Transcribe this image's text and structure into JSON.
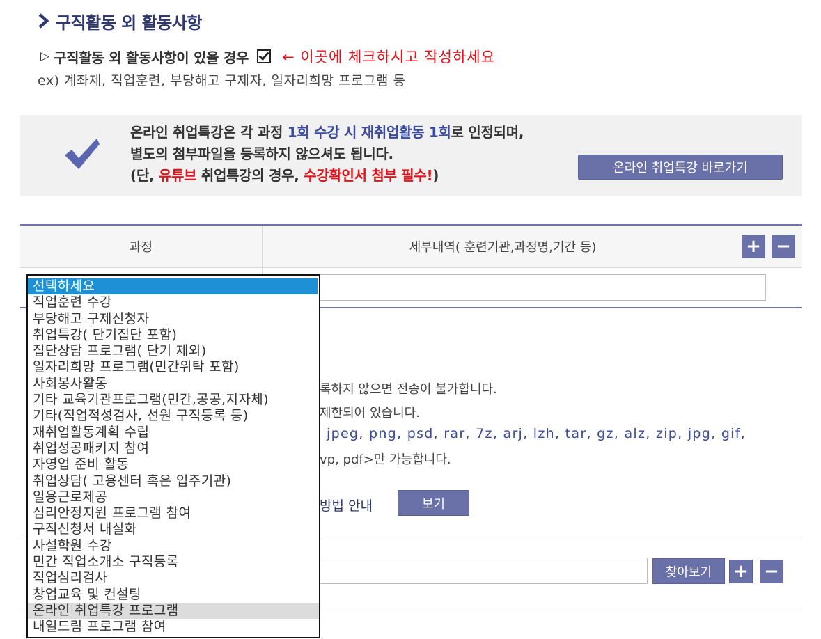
{
  "section": {
    "title": "구직활동 외 활동사항"
  },
  "activity_question": {
    "prefix": "▷",
    "label": "구직활동 외 활동사항이 있을 경우",
    "checked": true,
    "hint": "← 이곳에 체크하시고 작성하세요",
    "example": "ex) 계좌제, 직업훈련, 부당해고 구제자, 일자리희망 프로그램 등"
  },
  "info_box": {
    "line1_a": "온라인 취업특강은 각 과정 ",
    "line1_b": "1회 수강 시 재취업활동 1회",
    "line1_c": "로 인정되며,",
    "line2": "별도의 첨부파일을 등록하지 않으셔도 됩니다.",
    "line3_a": "(단, ",
    "line3_b": "유튜브",
    "line3_c": " 취업특강의 경우, ",
    "line3_d": "수강확인서 첨부 필수!",
    "line3_e": ")",
    "button": "온라인 취업특강 바로가기"
  },
  "table": {
    "col1": "과정",
    "col2": "세부내역( 훈련기관,과정명,기간 등)",
    "add": "+",
    "remove": "−"
  },
  "background_notice": {
    "line1": "록하지 않으면 전송이 불가합니다.",
    "line2": "제한되어 있습니다.",
    "line3": "jpeg, png, psd, rar, 7z, arj, lzh, tar, gz, alz, zip, jpg, gif,",
    "line4": "vp, pdf>만 가능합니다.",
    "guide": "방법 안내",
    "view_button": "보기",
    "find_button": "찾아보기",
    "add": "+",
    "remove": "−"
  },
  "dropdown": {
    "selected": "선택하세요",
    "options": [
      "선택하세요",
      "직업훈련 수강",
      "부당해고 구제신청자",
      "취업특강( 단기집단 포함)",
      "집단상담 프로그램( 단기 제외)",
      "일자리희망 프로그램(민간위탁 포함)",
      "사회봉사활동",
      "기타 교육기관프로그램(민간,공공,지자체)",
      "기타(직업적성검사, 선원 구직등록 등)",
      "재취업활동계획 수립",
      "취업성공패키지 참여",
      "자영업 준비 활동",
      "취업상담( 고용센터 혹은 입주기관)",
      "일용근로제공",
      "심리안정지원 프로그램 참여",
      "구직신청서 내실화",
      "사설학원 수강",
      "민간 직업소개소 구직등록",
      "직업심리검사",
      "창업교육 및 컨설팅",
      "온라인 취업특강 프로그램",
      "내일드림 프로그램 참여"
    ],
    "highlighted": "온라인 취업특강 프로그램"
  },
  "colors": {
    "accent": "#6a71a8",
    "title": "#2f3770",
    "alert": "#e8121a",
    "selection": "#1e90d6"
  }
}
